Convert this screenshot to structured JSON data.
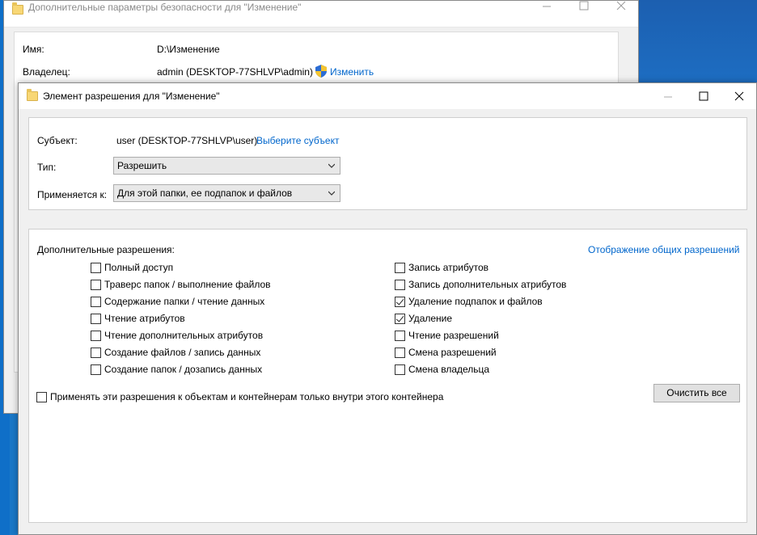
{
  "back_window": {
    "title": "Дополнительные параметры безопасности  для \"Изменение\"",
    "name_label": "Имя:",
    "name_value": "D:\\Изменение",
    "owner_label": "Владелец:",
    "owner_value": "admin (DESKTOP-77SHLVP\\admin)",
    "change_link": "Изменить"
  },
  "front_window": {
    "title": "Элемент разрешения для \"Изменение\"",
    "subject_label": "Субъект:",
    "subject_value": "user (DESKTOP-77SHLVP\\user)",
    "select_subject_link": "Выберите субъект",
    "type_label": "Тип:",
    "type_value": "Разрешить",
    "applies_label": "Применяется к:",
    "applies_value": "Для этой папки, ее подпапок и файлов",
    "advanced_label": "Дополнительные разрешения:",
    "show_basic_link": "Отображение общих разрешений",
    "permissions_left": [
      {
        "label": "Полный доступ",
        "checked": false
      },
      {
        "label": "Траверс папок / выполнение файлов",
        "checked": false
      },
      {
        "label": "Содержание папки / чтение данных",
        "checked": false
      },
      {
        "label": "Чтение атрибутов",
        "checked": false
      },
      {
        "label": "Чтение дополнительных атрибутов",
        "checked": false
      },
      {
        "label": "Создание файлов / запись данных",
        "checked": false
      },
      {
        "label": "Создание папок / дозапись данных",
        "checked": false
      }
    ],
    "permissions_right": [
      {
        "label": "Запись атрибутов",
        "checked": false
      },
      {
        "label": "Запись дополнительных атрибутов",
        "checked": false
      },
      {
        "label": "Удаление подпапок и файлов",
        "checked": true
      },
      {
        "label": "Удаление",
        "checked": true
      },
      {
        "label": "Чтение разрешений",
        "checked": false
      },
      {
        "label": "Смена разрешений",
        "checked": false
      },
      {
        "label": "Смена владельца",
        "checked": false
      }
    ],
    "apply_inside_label": "Применять эти разрешения к объектам и контейнерам только внутри этого контейнера",
    "apply_inside_checked": false,
    "clear_all_button": "Очистить все"
  }
}
